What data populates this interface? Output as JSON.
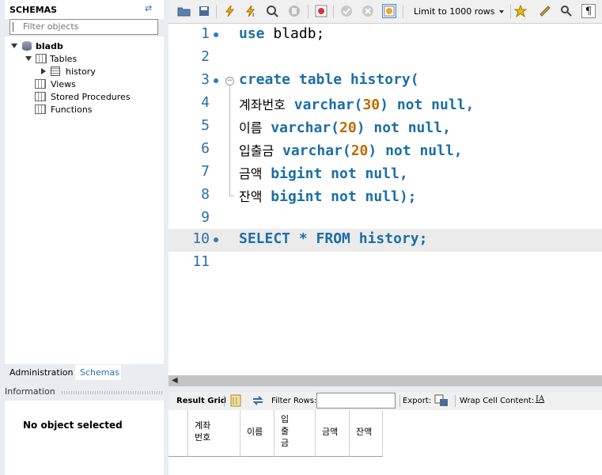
{
  "sidebar": {
    "title": "SCHEMAS",
    "filter_placeholder": "Filter objects",
    "tree": {
      "database": "bladb",
      "tables_label": "Tables",
      "table_item": "history",
      "views_label": "Views",
      "procedures_label": "Stored Procedures",
      "functions_label": "Functions"
    },
    "tabs": [
      "Administration",
      "Schemas"
    ],
    "info_title": "Information",
    "info_text": "No object selected"
  },
  "toolbar": {
    "limit_label": "Limit to 1000 rows"
  },
  "editor": {
    "line_numbers": [
      "1",
      "2",
      "3",
      "4",
      "5",
      "6",
      "7",
      "8",
      "9",
      "10",
      "11"
    ],
    "lines": {
      "l1_kw": "use",
      "l1_rest": " bladb;",
      "l3_kw": "create table",
      "l3_name": " history(",
      "l4_col": "계좌번호",
      "l4_type": " varchar(",
      "l4_num": "30",
      "l4_rest": ") ",
      "l4_kw": "not null",
      "l4_end": ",",
      "l5_col": "이름",
      "l5_type": " varchar(",
      "l5_num": "20",
      "l5_rest": ") ",
      "l5_kw": "not null",
      "l5_end": ",",
      "l6_col": "입출금",
      "l6_type": " varchar(",
      "l6_num": "20",
      "l6_rest": ") ",
      "l6_kw": "not null",
      "l6_end": ",",
      "l7_col": "금액",
      "l7_type": " bigint not null",
      "l7_end": ",",
      "l8_col": "잔액",
      "l8_type": " bigint not null",
      "l8_end": ");",
      "l10_select": "SELECT",
      "l10_star": " * ",
      "l10_from": "FROM",
      "l10_rest": " history;"
    }
  },
  "result_toolbar": {
    "result_grid": "Result Grid",
    "filter_rows": "Filter Rows:",
    "export": "Export:",
    "wrap": "Wrap Cell Content:"
  },
  "result_grid": {
    "columns": [
      "계좌\n번호",
      "이름",
      "입\n출\n금",
      "금액",
      "잔액"
    ]
  }
}
